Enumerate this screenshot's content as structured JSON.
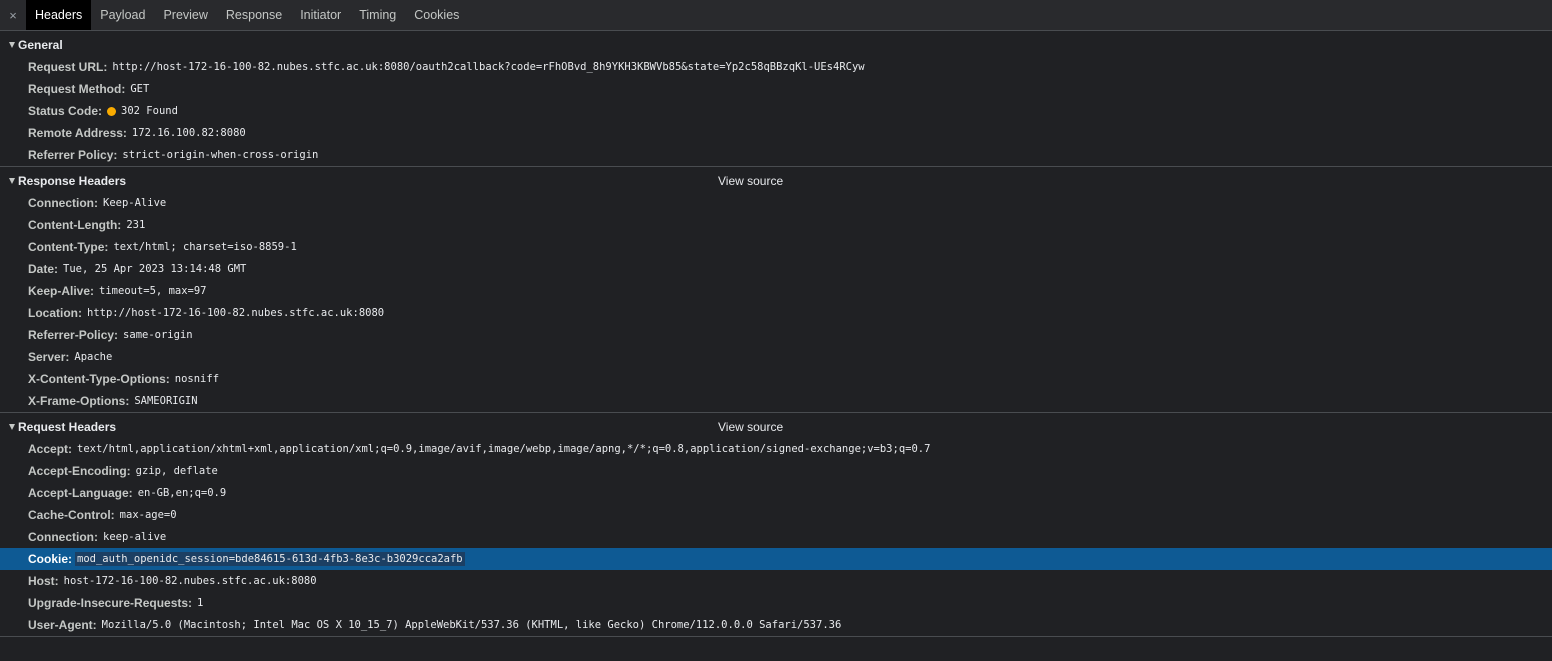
{
  "tabs": {
    "close_glyph": "×",
    "items": [
      "Headers",
      "Payload",
      "Preview",
      "Response",
      "Initiator",
      "Timing",
      "Cookies"
    ],
    "active": "Headers"
  },
  "general": {
    "title": "General",
    "rows": [
      {
        "name": "Request URL:",
        "value": "http://host-172-16-100-82.nubes.stfc.ac.uk:8080/oauth2callback?code=rFhOBvd_8h9YKH3KBWVb85&state=Yp2c58qBBzqKl-UEs4RCyw"
      },
      {
        "name": "Request Method:",
        "value": "GET"
      },
      {
        "name": "Status Code:",
        "value": "302 Found",
        "status_color": "#f9ab00"
      },
      {
        "name": "Remote Address:",
        "value": "172.16.100.82:8080"
      },
      {
        "name": "Referrer Policy:",
        "value": "strict-origin-when-cross-origin"
      }
    ]
  },
  "response_headers": {
    "title": "Response Headers",
    "view_source": "View source",
    "rows": [
      {
        "name": "Connection:",
        "value": "Keep-Alive"
      },
      {
        "name": "Content-Length:",
        "value": "231"
      },
      {
        "name": "Content-Type:",
        "value": "text/html; charset=iso-8859-1"
      },
      {
        "name": "Date:",
        "value": "Tue, 25 Apr 2023 13:14:48 GMT"
      },
      {
        "name": "Keep-Alive:",
        "value": "timeout=5, max=97"
      },
      {
        "name": "Location:",
        "value": "http://host-172-16-100-82.nubes.stfc.ac.uk:8080"
      },
      {
        "name": "Referrer-Policy:",
        "value": "same-origin"
      },
      {
        "name": "Server:",
        "value": "Apache"
      },
      {
        "name": "X-Content-Type-Options:",
        "value": "nosniff"
      },
      {
        "name": "X-Frame-Options:",
        "value": "SAMEORIGIN"
      }
    ]
  },
  "request_headers": {
    "title": "Request Headers",
    "view_source": "View source",
    "rows": [
      {
        "name": "Accept:",
        "value": "text/html,application/xhtml+xml,application/xml;q=0.9,image/avif,image/webp,image/apng,*/*;q=0.8,application/signed-exchange;v=b3;q=0.7"
      },
      {
        "name": "Accept-Encoding:",
        "value": "gzip, deflate"
      },
      {
        "name": "Accept-Language:",
        "value": "en-GB,en;q=0.9"
      },
      {
        "name": "Cache-Control:",
        "value": "max-age=0"
      },
      {
        "name": "Connection:",
        "value": "keep-alive"
      },
      {
        "name": "Cookie:",
        "value": "mod_auth_openidc_session=bde84615-613d-4fb3-8e3c-b3029cca2afb",
        "selected": true
      },
      {
        "name": "Host:",
        "value": "host-172-16-100-82.nubes.stfc.ac.uk:8080"
      },
      {
        "name": "Upgrade-Insecure-Requests:",
        "value": "1"
      },
      {
        "name": "User-Agent:",
        "value": "Mozilla/5.0 (Macintosh; Intel Mac OS X 10_15_7) AppleWebKit/537.36 (KHTML, like Gecko) Chrome/112.0.0.0 Safari/537.36"
      }
    ]
  },
  "colors": {
    "background": "#202124",
    "tabbar": "#292a2d",
    "selected_row": "#0e5a94",
    "status_dot": "#f9ab00"
  }
}
